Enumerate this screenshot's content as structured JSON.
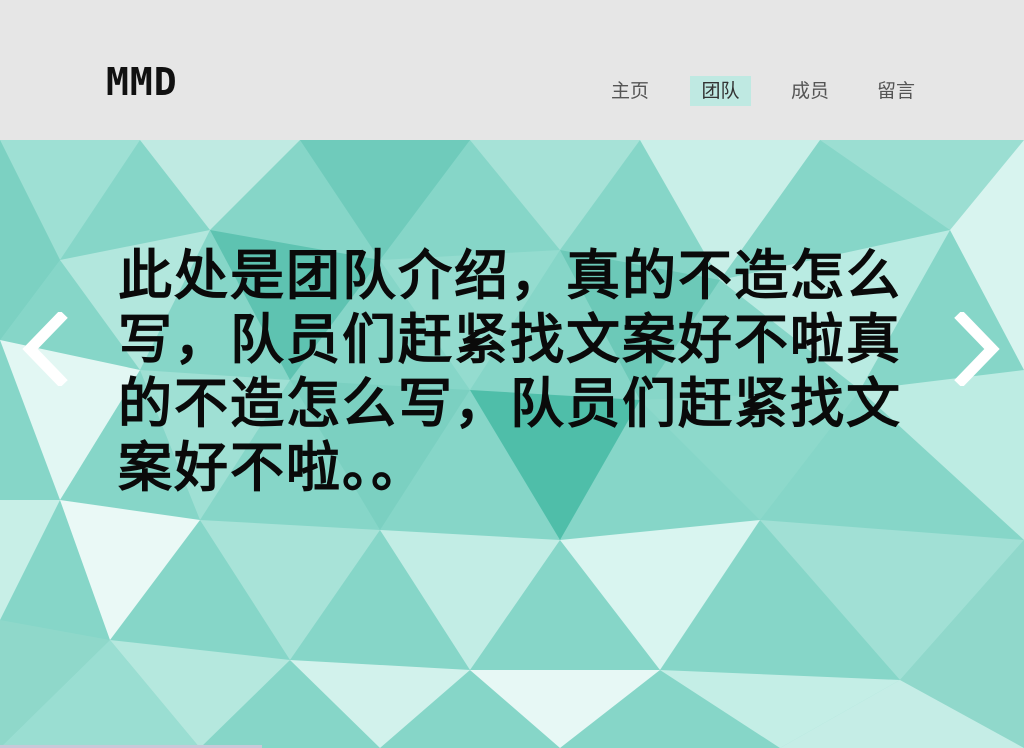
{
  "header": {
    "logo": "MMD",
    "nav": [
      {
        "label": "主页",
        "active": false
      },
      {
        "label": "团队",
        "active": true
      },
      {
        "label": "成员",
        "active": false
      },
      {
        "label": "留言",
        "active": false
      }
    ]
  },
  "hero": {
    "intro_text": "此处是团队介绍，真的不造怎么写，队员们赶紧找文案好不啦真的不造怎么写，队员们赶紧找文案好不啦。。",
    "prev_icon": "chevron-left-icon",
    "next_icon": "chevron-right-icon"
  },
  "colors": {
    "header_bg": "#e6e6e6",
    "active_nav_bg": "#bfe9e2",
    "hero_teal": "#7fd3c4",
    "text": "#0a0a0a"
  }
}
